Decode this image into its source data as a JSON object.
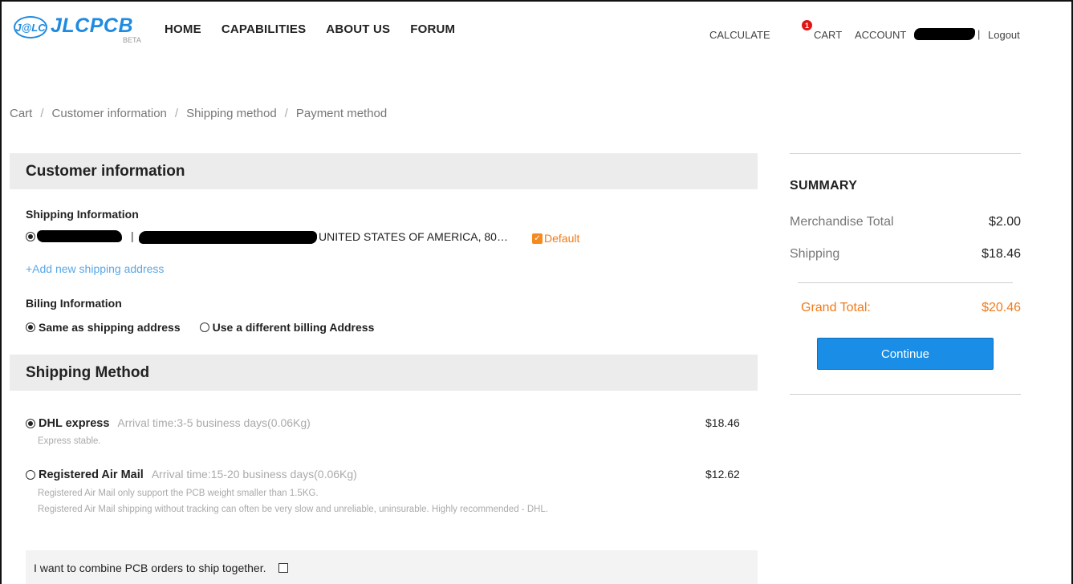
{
  "brand": {
    "badge": "J@LC",
    "name": "JLCPCB",
    "beta": "BETA"
  },
  "nav": [
    "HOME",
    "CAPABILITIES",
    "ABOUT US",
    "FORUM"
  ],
  "header_right": {
    "calculate": "CALCULATE",
    "cart": "CART",
    "cart_count": "1",
    "account": "ACCOUNT",
    "separator": "|",
    "logout": "Logout"
  },
  "breadcrumb": [
    "Cart",
    "Customer information",
    "Shipping method",
    "Payment method"
  ],
  "breadcrumb_sep": "/",
  "customer": {
    "title": "Customer information",
    "shipping_label": "Shipping Information",
    "address_pipe": "|",
    "address_text": "UNITED STATES OF AMERICA, 80…",
    "default_label": "Default",
    "add_address": "+Add new shipping address",
    "billing_label": "Biling Information",
    "billing_options": [
      "Same as shipping address",
      "Use a different billing Address"
    ],
    "billing_selected": 0
  },
  "shipping": {
    "title": "Shipping Method",
    "options": [
      {
        "name": "DHL express",
        "arrival": "Arrival time:3-5 business days(0.06Kg)",
        "price": "$18.46",
        "notes": [
          "Express stable."
        ],
        "selected": true
      },
      {
        "name": "Registered Air Mail",
        "arrival": "Arrival time:15-20 business days(0.06Kg)",
        "price": "$12.62",
        "notes": [
          "Registered Air Mail only support the PCB weight smaller than 1.5KG.",
          "Registered Air Mail shipping without tracking can often be very slow and unreliable, uninsurable. Highly recommended - DHL."
        ],
        "selected": false
      }
    ],
    "combine_label": "I want to combine PCB orders to ship together."
  },
  "summary": {
    "title": "SUMMARY",
    "merch_label": "Merchandise Total",
    "merch_value": "$2.00",
    "ship_label": "Shipping",
    "ship_value": "$18.46",
    "grand_label": "Grand Total:",
    "grand_value": "$20.46",
    "continue_label": "Continue"
  },
  "colors": {
    "brand_blue": "#1f8be0",
    "accent_orange": "#f07a1a",
    "button_blue": "#1a8ee6",
    "badge_red": "#e01515"
  }
}
